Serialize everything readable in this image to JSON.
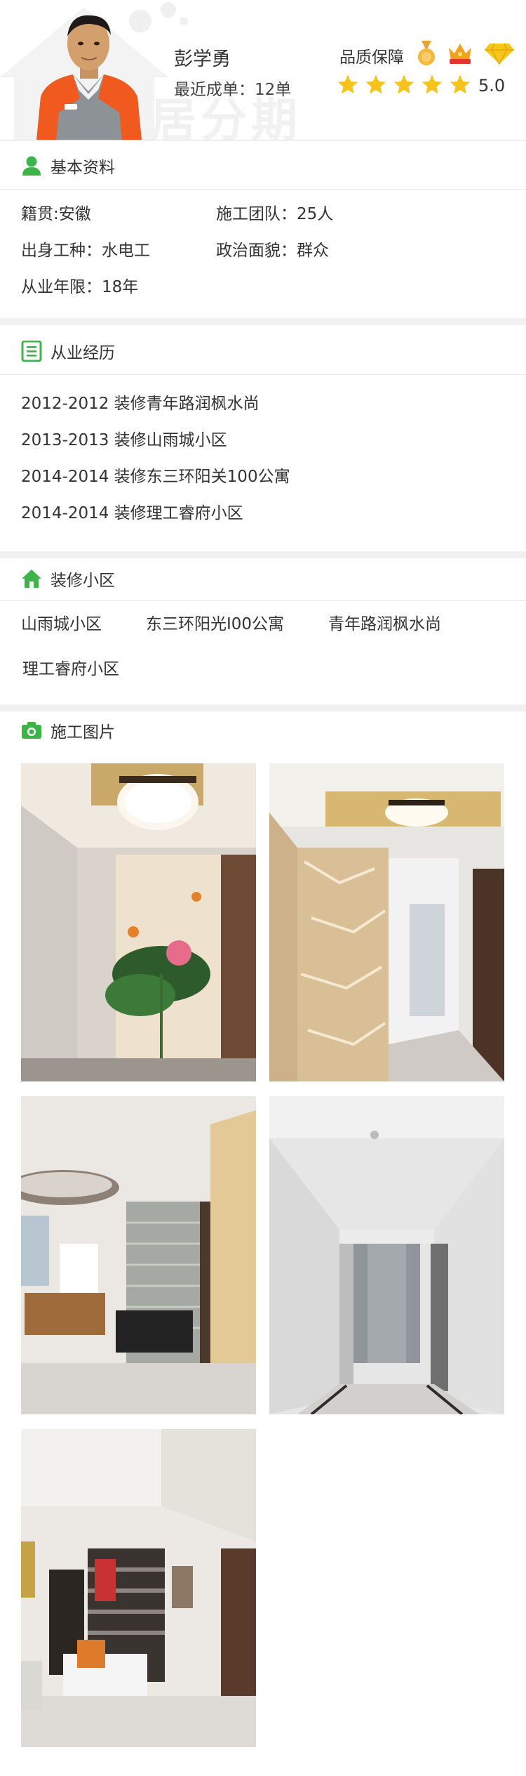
{
  "profile": {
    "name": "彭学勇",
    "orders_label": "最近成单：12单",
    "quality_label": "品质保障",
    "rating": "5.0",
    "stars": 5,
    "watermark_text": "居分期",
    "badges": [
      "medal-icon",
      "crown-badge-icon",
      "diamond-icon"
    ]
  },
  "basic": {
    "title": "基本资料",
    "hometown": "籍贯:安徽",
    "team": "施工团队：25人",
    "trade": "出身工种：水电工",
    "politics": "政治面貌：群众",
    "years": "从业年限：18年"
  },
  "experience": {
    "title": "从业经历",
    "items": [
      "2012-2012 装修青年路润枫水尚",
      "2013-2013 装修山雨城小区",
      "2014-2014 装修东三环阳关100公寓",
      "2014-2014 装修理工睿府小区"
    ]
  },
  "communities": {
    "title": "装修小区",
    "items": [
      "山雨城小区",
      "东三环阳光I00公寓",
      "青年路润枫水尚",
      "理工睿府小区"
    ]
  },
  "photos": {
    "title": "施工图片",
    "count": 5
  },
  "colors": {
    "accent_green": "#3cb449",
    "star_yellow": "#f7c21b",
    "divider_gray": "#f1f1f1"
  }
}
